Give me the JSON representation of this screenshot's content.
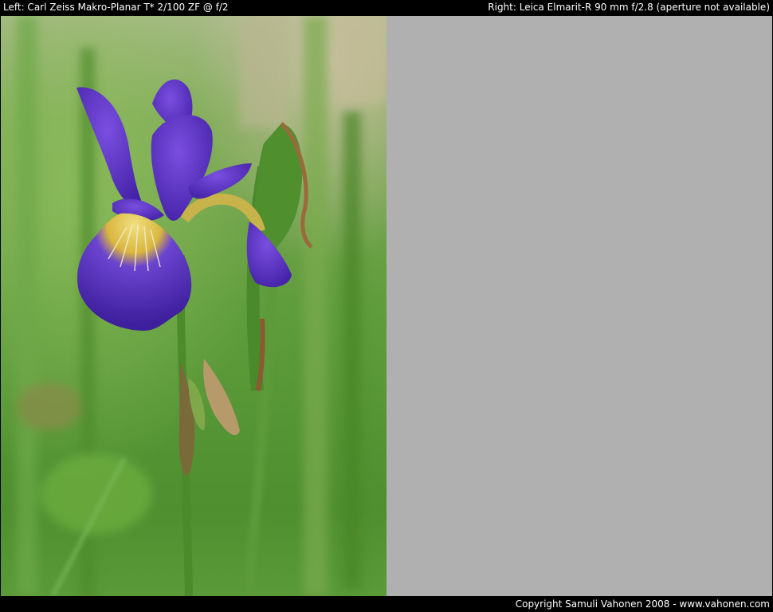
{
  "header": {
    "left_caption": "Left: Carl Zeiss Makro-Planar T* 2/100 ZF @ f/2",
    "right_caption": "Right: Leica Elmarit-R 90 mm f/2.8 (aperture not available)"
  },
  "footer": {
    "copyright": "Copyright Samuli Vahonen 2008 - www.vahonen.com"
  },
  "colors": {
    "frame": "#000000",
    "placeholder_panel": "#b0b0b0",
    "background_green": "#5e9a3c",
    "iris_purple": "#5a2fc4",
    "iris_yellow": "#d8b640",
    "stem_green": "#4f8a2e"
  }
}
